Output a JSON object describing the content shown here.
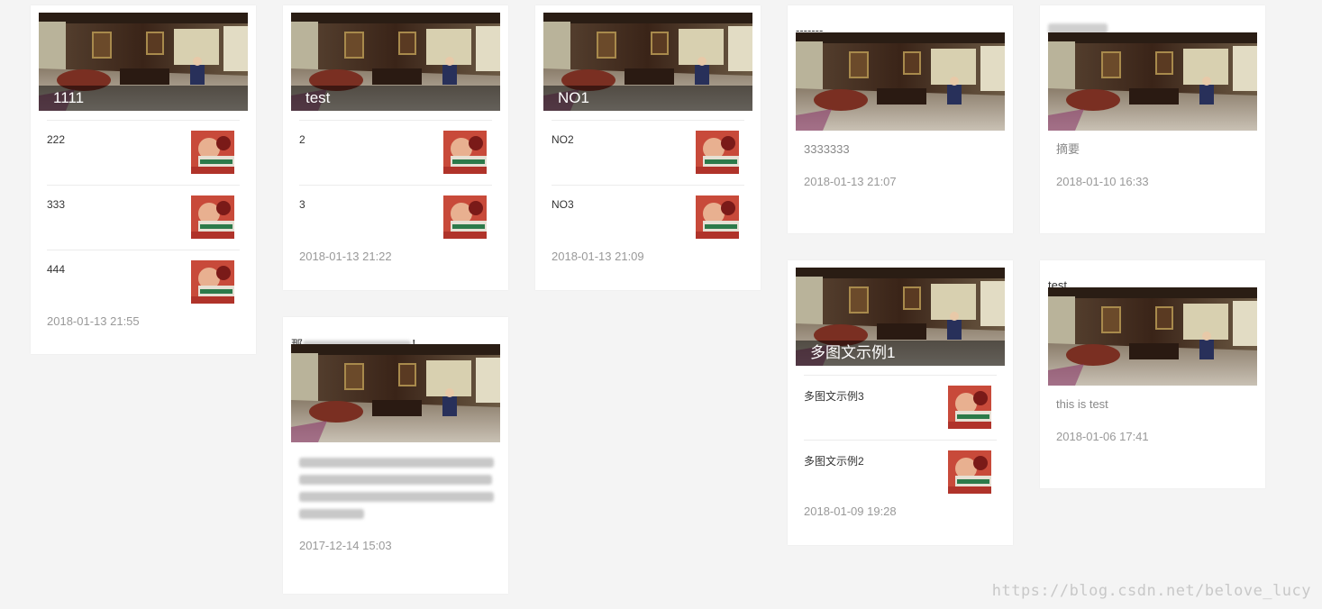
{
  "watermark": "https://blog.csdn.net/belove_lucy",
  "cards": [
    {
      "cover_title": "1111",
      "items": [
        {
          "title": "222"
        },
        {
          "title": "333"
        },
        {
          "title": "444"
        }
      ],
      "date": "2018-01-13 21:55"
    },
    {
      "cover_title": "test",
      "items": [
        {
          "title": "2"
        },
        {
          "title": "3"
        }
      ],
      "date": "2018-01-13 21:22"
    },
    {
      "cover_title": "NO1",
      "items": [
        {
          "title": "NO2"
        },
        {
          "title": "NO3"
        }
      ],
      "date": "2018-01-13 21:09"
    },
    {
      "title": "-------",
      "summary": "3333333",
      "date": "2018-01-13 21:07"
    },
    {
      "title": "",
      "summary": "摘要",
      "date": "2018-01-10 16:33"
    },
    {
      "title": "那",
      "title_tail": "！",
      "summary": "",
      "date": "2017-12-14 15:03"
    },
    {
      "cover_title": "多图文示例1",
      "items": [
        {
          "title": "多图文示例3"
        },
        {
          "title": "多图文示例2"
        }
      ],
      "date": "2018-01-09 19:28"
    },
    {
      "title": "test",
      "summary": "this is test",
      "date": "2018-01-06 17:41"
    }
  ]
}
